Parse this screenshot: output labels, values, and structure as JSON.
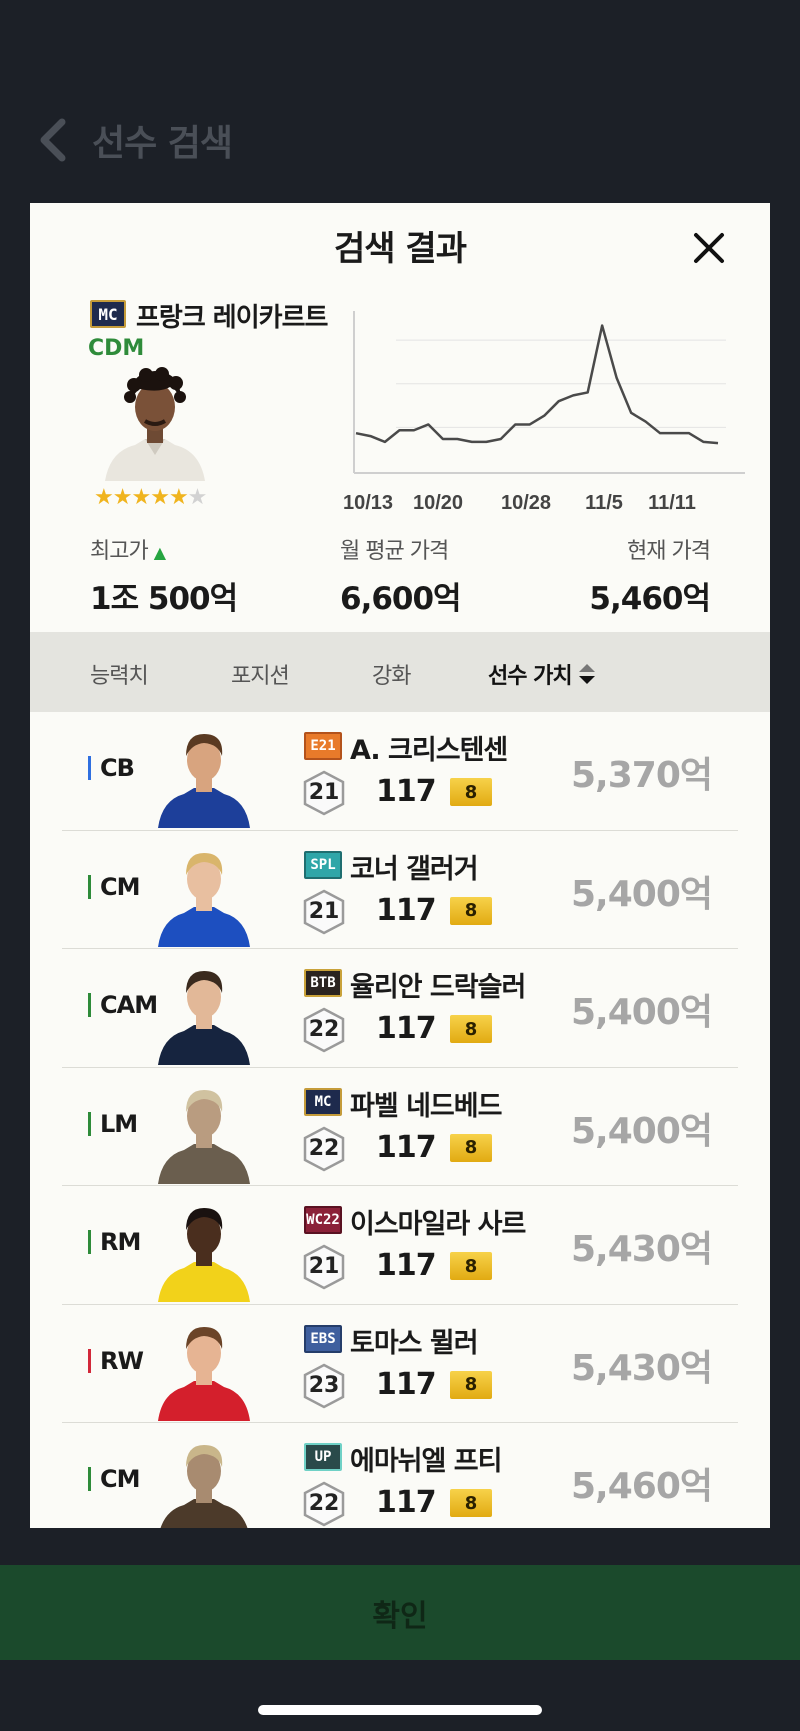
{
  "background": {
    "title": "선수 검색"
  },
  "modal": {
    "title": "검색 결과"
  },
  "summary": {
    "season_badge": "MC",
    "name": "프랑크 레이카르트",
    "position": "CDM",
    "stars_filled": 5,
    "stars_total": 6
  },
  "chart_data": {
    "type": "line",
    "x_labels": [
      "10/13",
      "10/20",
      "10/28",
      "11/5",
      "11/11"
    ],
    "values": [
      5800,
      5700,
      5500,
      5900,
      5900,
      6100,
      5600,
      5600,
      5500,
      5500,
      5600,
      6100,
      6100,
      6400,
      6900,
      7100,
      7200,
      9500,
      7700,
      6500,
      6200,
      5800,
      5800,
      5800,
      5500,
      5460
    ],
    "grid": true
  },
  "stats": {
    "highest_label": "최고가",
    "highest_value": "1조 500억",
    "monthly_avg_label": "월 평균 가격",
    "monthly_avg_value": "6,600억",
    "current_label": "현재 가격",
    "current_value": "5,460억"
  },
  "tabs": [
    {
      "label": "능력치"
    },
    {
      "label": "포지션"
    },
    {
      "label": "강화"
    },
    {
      "label": "선수 가치"
    }
  ],
  "players": [
    {
      "pos": "CB",
      "pos_color": "#2f6fe0",
      "season": "E21",
      "season_bg": "#e87a2a",
      "season_border": "#b3521b",
      "name": "A. 크리스텐센",
      "level": "21",
      "ovr": "117",
      "upgrade": "8",
      "price": "5,370억",
      "kit": "#1d3f9a",
      "skin": "#d8a47f",
      "hair": "#5a3a22"
    },
    {
      "pos": "CM",
      "pos_color": "#2e8b3a",
      "season": "SPL",
      "season_bg": "#2fa6a8",
      "season_border": "#1f6e70",
      "name": "코너 갤러거",
      "level": "21",
      "ovr": "117",
      "upgrade": "8",
      "price": "5,400억",
      "kit": "#1d4fc0",
      "skin": "#e8bfa0",
      "hair": "#d9b56b"
    },
    {
      "pos": "CAM",
      "pos_color": "#2e8b3a",
      "season": "BTB",
      "season_bg": "#2a2320",
      "season_border": "#c9a23a",
      "name": "율리안 드락슬러",
      "level": "22",
      "ovr": "117",
      "upgrade": "8",
      "price": "5,400억",
      "kit": "#16243f",
      "skin": "#e2b898",
      "hair": "#3a2a1e"
    },
    {
      "pos": "LM",
      "pos_color": "#2e8b3a",
      "season": "MC",
      "season_bg": "#1e2a4d",
      "season_border": "#c49b3a",
      "name": "파벨 네드베드",
      "level": "22",
      "ovr": "117",
      "upgrade": "8",
      "price": "5,400억",
      "kit": "#6a5e4e",
      "skin": "#b99c80",
      "hair": "#d0c2a0"
    },
    {
      "pos": "RM",
      "pos_color": "#2e8b3a",
      "season": "WC22",
      "season_bg": "#8b2138",
      "season_border": "#5a1222",
      "name": "이스마일라 사르",
      "level": "21",
      "ovr": "117",
      "upgrade": "8",
      "price": "5,430억",
      "kit": "#f2d21a",
      "skin": "#4a2e1e",
      "hair": "#1a1210"
    },
    {
      "pos": "RW",
      "pos_color": "#d2283a",
      "season": "EBS",
      "season_bg": "#3f5f9e",
      "season_border": "#253d6a",
      "name": "토마스 뮐러",
      "level": "23",
      "ovr": "117",
      "upgrade": "8",
      "price": "5,430억",
      "kit": "#d41f2c",
      "skin": "#e6b493",
      "hair": "#6b4428"
    },
    {
      "pos": "CM",
      "pos_color": "#2e8b3a",
      "season": "UP",
      "season_bg": "#2a4a4a",
      "season_border": "#6fd1c6",
      "name": "에마뉘엘 프티",
      "level": "22",
      "ovr": "117",
      "upgrade": "8",
      "price": "5,460억",
      "kit": "#4c3a2a",
      "skin": "#a88b70",
      "hair": "#c9b68a"
    }
  ],
  "confirm": {
    "label": "확인"
  }
}
